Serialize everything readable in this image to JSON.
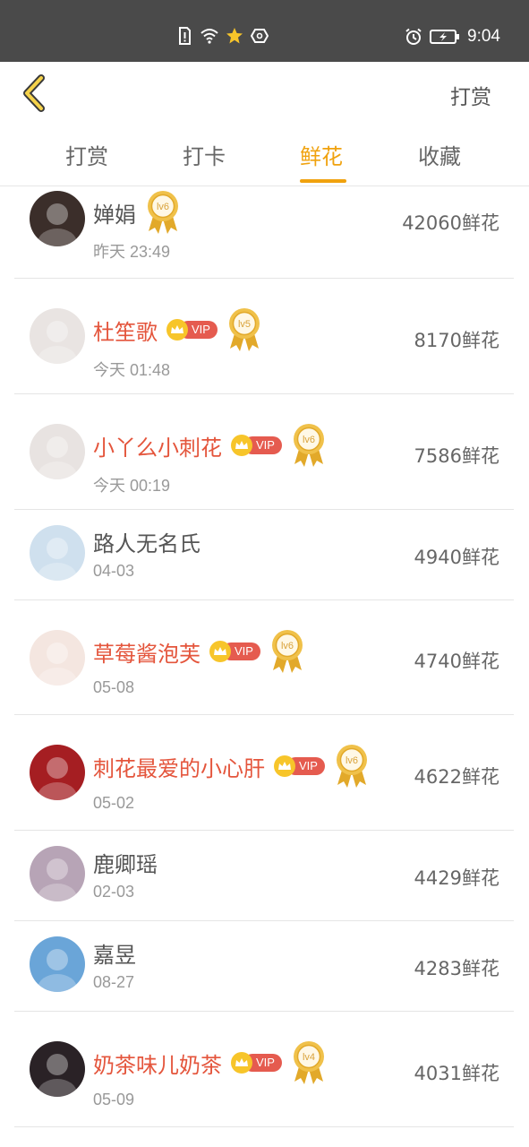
{
  "status_bar": {
    "time": "9:04"
  },
  "header": {
    "action_label": "打赏"
  },
  "tabs": [
    {
      "label": "打赏",
      "active": false
    },
    {
      "label": "打卡",
      "active": false
    },
    {
      "label": "鲜花",
      "active": true
    },
    {
      "label": "收藏",
      "active": false
    }
  ],
  "vip_label": "VIP",
  "rows": [
    {
      "name": "婵娟",
      "vip": false,
      "level": "lv6",
      "time": "昨天 23:49",
      "count": "42060鲜花",
      "avatar_color": "#3b2e2a"
    },
    {
      "name": "杜笙歌",
      "vip": true,
      "level": "lv5",
      "time": "今天 01:48",
      "count": "8170鲜花",
      "avatar_color": "#e9e4e2"
    },
    {
      "name": "小丫么小刺花",
      "vip": true,
      "level": "lv6",
      "time": "今天 00:19",
      "count": "7586鲜花",
      "avatar_color": "#e8e3e1"
    },
    {
      "name": "路人无名氏",
      "vip": false,
      "level": "",
      "time": "04-03",
      "count": "4940鲜花",
      "avatar_color": "#cfe0ee"
    },
    {
      "name": "草莓酱泡芙",
      "vip": true,
      "level": "lv6",
      "time": "05-08",
      "count": "4740鲜花",
      "avatar_color": "#f4e6e0"
    },
    {
      "name": "刺花最爱的小心肝",
      "vip": true,
      "level": "lv6",
      "time": "05-02",
      "count": "4622鲜花",
      "avatar_color": "#a51e22"
    },
    {
      "name": "鹿卿瑶",
      "vip": false,
      "level": "",
      "time": "02-03",
      "count": "4429鲜花",
      "avatar_color": "#b7a4b6"
    },
    {
      "name": "嘉昱",
      "vip": false,
      "level": "",
      "time": "08-27",
      "count": "4283鲜花",
      "avatar_color": "#6aa5d8"
    },
    {
      "name": "奶茶味儿奶茶",
      "vip": true,
      "level": "lv4",
      "time": "05-09",
      "count": "4031鲜花",
      "avatar_color": "#2a2226"
    }
  ]
}
